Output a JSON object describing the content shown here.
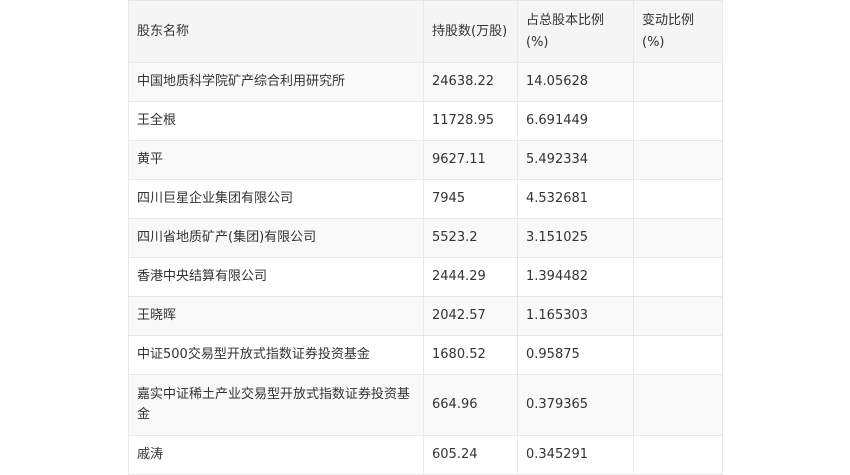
{
  "table": {
    "headers": [
      "股东名称",
      "持股数(万股)",
      "占总股本比例(%)",
      "变动比例(%)"
    ],
    "rows": [
      {
        "name": "中国地质科学院矿产综合利用研究所",
        "shares": "24638.22",
        "ratio": "14.05628",
        "change": ""
      },
      {
        "name": "王全根",
        "shares": "11728.95",
        "ratio": "6.691449",
        "change": ""
      },
      {
        "name": "黄平",
        "shares": "9627.11",
        "ratio": "5.492334",
        "change": ""
      },
      {
        "name": "四川巨星企业集团有限公司",
        "shares": "7945",
        "ratio": "4.532681",
        "change": ""
      },
      {
        "name": "四川省地质矿产(集团)有限公司",
        "shares": "5523.2",
        "ratio": "3.151025",
        "change": ""
      },
      {
        "name": "香港中央结算有限公司",
        "shares": "2444.29",
        "ratio": "1.394482",
        "change": ""
      },
      {
        "name": "王晓晖",
        "shares": "2042.57",
        "ratio": "1.165303",
        "change": ""
      },
      {
        "name": "中证500交易型开放式指数证券投资基金",
        "shares": "1680.52",
        "ratio": "0.95875",
        "change": ""
      },
      {
        "name": "嘉实中证稀土产业交易型开放式指数证券投资基金",
        "shares": "664.96",
        "ratio": "0.379365",
        "change": ""
      },
      {
        "name": "戚涛",
        "shares": "605.24",
        "ratio": "0.345291",
        "change": ""
      }
    ]
  }
}
